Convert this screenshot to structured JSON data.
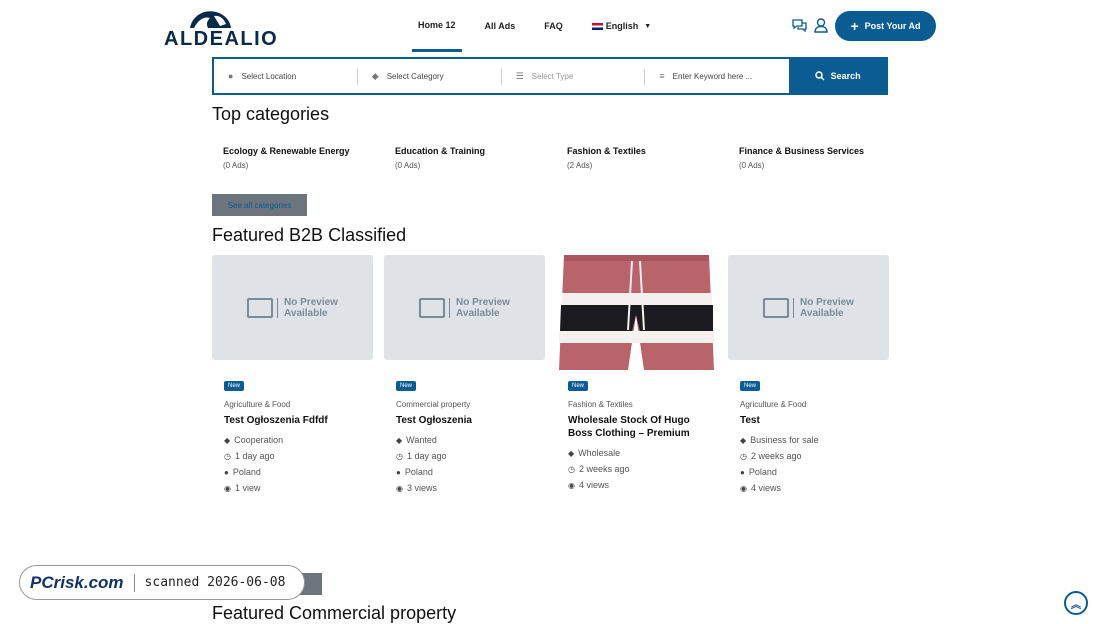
{
  "brand": {
    "name": "ALDEALIO",
    "accent": "#0a5c93"
  },
  "nav": [
    {
      "label": "Home 12",
      "active": true
    },
    {
      "label": "All Ads"
    },
    {
      "label": "FAQ"
    },
    {
      "label": "English"
    }
  ],
  "header": {
    "post_ad": "Post Your Ad",
    "icons": [
      "chat-icon",
      "user-icon"
    ]
  },
  "search": {
    "location": "Select Location",
    "category": "Select Category",
    "type": "Select Type",
    "keyword_placeholder": "Enter Keyword here ...",
    "button": "Search"
  },
  "top_categories": {
    "heading": "Top categories",
    "items": [
      {
        "name": "Ecology & Renewable Energy",
        "count": "(0 Ads)"
      },
      {
        "name": "Education & Training",
        "count": "(0 Ads)"
      },
      {
        "name": "Fashion & Textiles",
        "count": "(2 Ads)"
      },
      {
        "name": "Finance & Business Services",
        "count": "(0 Ads)"
      }
    ],
    "see_all": "See all categories"
  },
  "featured": {
    "heading": "Featured B2B Classified",
    "no_preview_line1": "No Preview",
    "no_preview_line2": "Available",
    "cards": [
      {
        "badge": "New",
        "category": "Agriculture & Food",
        "title": "Test Ogłoszenia Fdfdf",
        "type": "Cooperation",
        "time": "1 day ago",
        "location": "Poland",
        "views": "1 view"
      },
      {
        "badge": "New",
        "category": "Commercial property",
        "title": "Test Ogłoszenia",
        "type": "Wanted",
        "time": "1 day ago",
        "location": "Poland",
        "views": "3 views"
      },
      {
        "badge": "New",
        "category": "Fashion & Textiles",
        "title": "Wholesale Stock Of Hugo Boss Clothing – Premium",
        "type": "Wholesale",
        "time": "2 weeks ago",
        "location": "",
        "views": "4 views"
      },
      {
        "badge": "New",
        "category": "Agriculture & Food",
        "title": "Test",
        "type": "Business for sale",
        "time": "2 weeks ago",
        "location": "Poland",
        "views": "4 views"
      }
    ]
  },
  "next_heading": "Featured Commercial property",
  "watermark": {
    "logo": "PCrisk.com",
    "text": "scanned 2026-06-08"
  }
}
